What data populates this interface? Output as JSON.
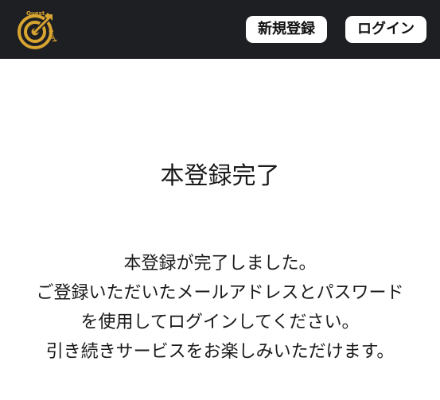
{
  "header": {
    "logo": {
      "icon": "target-arrow-logo-icon",
      "text_top": "Quest",
      "text_side": "Surf",
      "gold": "#d9a531"
    },
    "register_label": "新規登録",
    "login_label": "ログイン",
    "background": "#1e1f22"
  },
  "main": {
    "title": "本登録完了",
    "message_lines": [
      "本登録が完了しました。",
      "ご登録いただいたメールアドレスとパスワード",
      "を使用してログインしてください。",
      "引き続きサービスをお楽しみいただけます。"
    ]
  }
}
